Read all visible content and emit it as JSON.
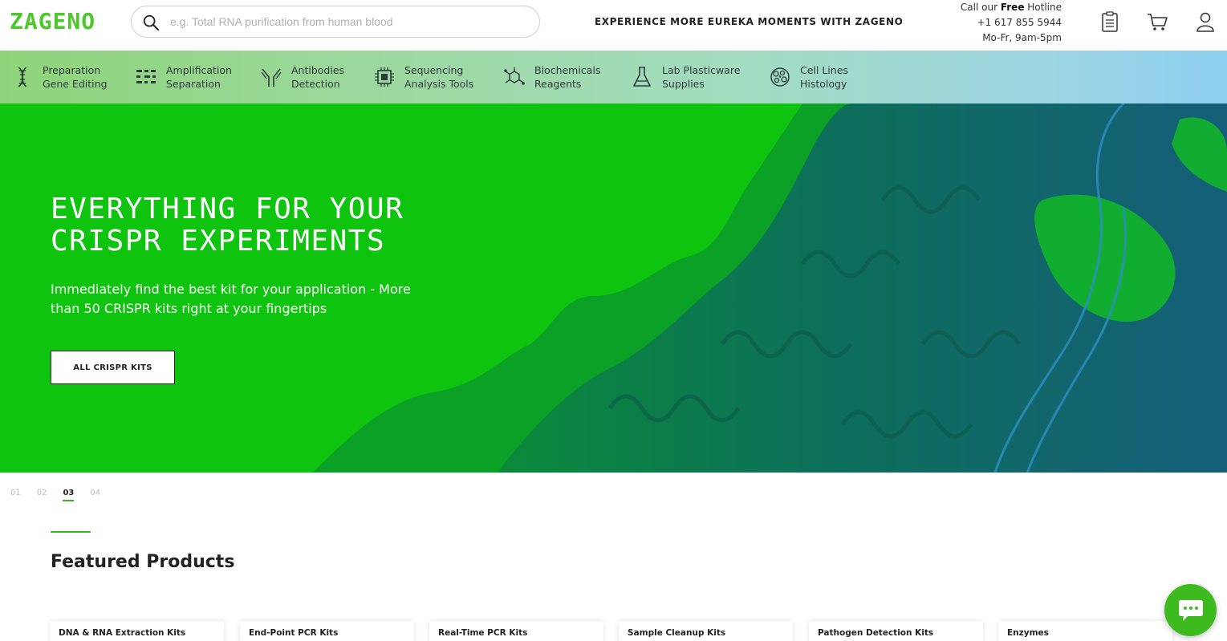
{
  "header": {
    "logo": "ZAGENO",
    "search_placeholder": "e.g. Total RNA purification from human blood",
    "tagline": "EXPERIENCE MORE EUREKA MOMENTS WITH ZAGENO",
    "hotline": {
      "prefix": "Call our ",
      "bold": "Free",
      "suffix": " Hotline",
      "phone": "+1 617 855 5944",
      "hours": "Mo-Fr, 9am-5pm"
    },
    "icons": [
      "clipboard-icon",
      "cart-icon",
      "user-icon"
    ]
  },
  "categories": [
    {
      "line1": "Preparation",
      "line2": "Gene Editing",
      "icon": "dna-icon"
    },
    {
      "line1": "Amplification",
      "line2": "Separation",
      "icon": "gel-bands-icon"
    },
    {
      "line1": "Antibodies",
      "line2": "Detection",
      "icon": "antibody-icon"
    },
    {
      "line1": "Sequencing",
      "line2": "Analysis Tools",
      "icon": "chip-icon"
    },
    {
      "line1": "Biochemicals",
      "line2": "Reagents",
      "icon": "molecule-icon"
    },
    {
      "line1": "Lab Plasticware",
      "line2": "Supplies",
      "icon": "flask-icon"
    },
    {
      "line1": "Cell Lines",
      "line2": "Histology",
      "icon": "cells-icon"
    }
  ],
  "hero": {
    "title_line1": "EVERYTHING FOR YOUR",
    "title_line2": "CRISPR EXPERIMENTS",
    "subtitle": "Immediately find the best kit for your application - More than 50 CRISPR kits right at your fingertips",
    "button": "ALL CRISPR KITS"
  },
  "slides": {
    "items": [
      "01",
      "02",
      "03",
      "04"
    ],
    "active": "03"
  },
  "featured": {
    "title": "Featured Products",
    "cards": [
      "DNA & RNA Extraction Kits",
      "End-Point PCR Kits",
      "Real-Time PCR Kits",
      "Sample Cleanup Kits",
      "Pathogen Detection Kits",
      "Enzymes"
    ]
  },
  "chat": {
    "icon": "chat-icon"
  },
  "colors": {
    "brand_green": "#4cc92a",
    "hero_green": "#0fc40f",
    "accent": "#3cb81e"
  }
}
